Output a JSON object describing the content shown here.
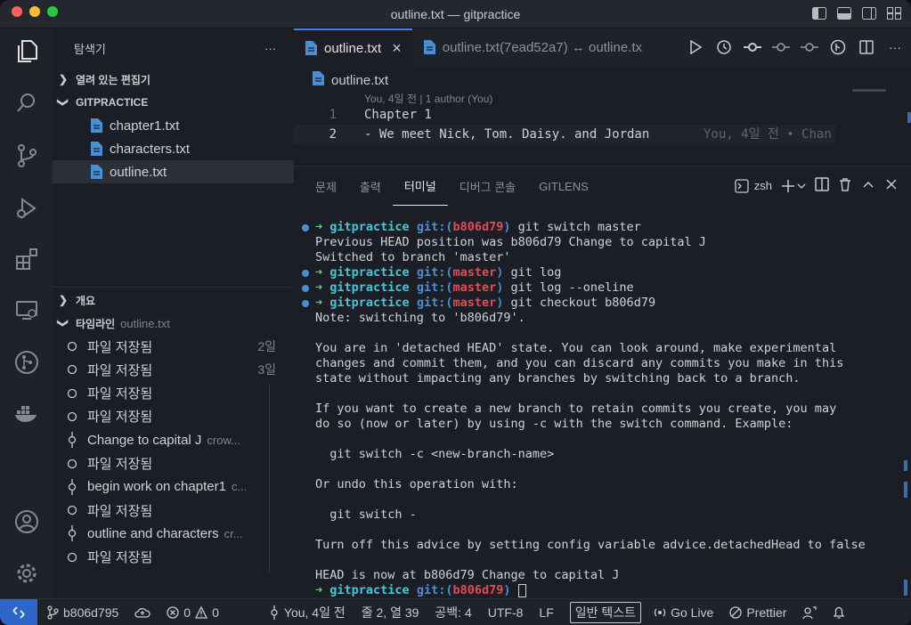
{
  "window": {
    "title": "outline.txt — gitpractice"
  },
  "sidebar": {
    "title": "탐색기",
    "more": "···",
    "open_editors": "열려 있는 편집기",
    "folder": "GITPRACTICE",
    "files": [
      "chapter1.txt",
      "characters.txt",
      "outline.txt"
    ],
    "outline_section": "개요",
    "timeline_section": "타임라인",
    "timeline_file": "outline.txt",
    "timeline": [
      {
        "label": "파일 저장됨",
        "meta": "",
        "time": "2일"
      },
      {
        "label": "파일 저장됨",
        "meta": "",
        "time": "3일"
      },
      {
        "label": "파일 저장됨",
        "meta": "",
        "time": ""
      },
      {
        "label": "파일 저장됨",
        "meta": "",
        "time": ""
      },
      {
        "label": "Change to capital J",
        "meta": "crow...",
        "time": ""
      },
      {
        "label": "파일 저장됨",
        "meta": "",
        "time": ""
      },
      {
        "label": "begin work on chapter1",
        "meta": "c...",
        "time": ""
      },
      {
        "label": "파일 저장됨",
        "meta": "",
        "time": ""
      },
      {
        "label": "outline and characters",
        "meta": "cr...",
        "time": ""
      },
      {
        "label": "파일 저장됨",
        "meta": "",
        "time": ""
      }
    ]
  },
  "editor": {
    "tabs": [
      {
        "label": "outline.txt",
        "close": "×"
      },
      {
        "label": "outline.txt(7ead52a7) ↔ outline.tx"
      }
    ],
    "breadcrumb": "outline.txt",
    "blame_header": "You, 4일 전 | 1 author (You)",
    "lines": [
      {
        "num": "1",
        "text": "Chapter 1"
      },
      {
        "num": "2",
        "text": "- We meet Nick, Tom. Daisy. and Jordan"
      }
    ],
    "inline_blame": "You, 4일 전 • Chan"
  },
  "panel": {
    "tabs": [
      "문제",
      "출력",
      "터미널",
      "디버그 콘솔",
      "GITLENS"
    ],
    "shell": "zsh",
    "terminal": [
      {
        "kind": "prompt",
        "branch": "b806d79",
        "cmd": " git switch master"
      },
      {
        "kind": "text",
        "text": "Previous HEAD position was b806d79 Change to capital J"
      },
      {
        "kind": "text",
        "text": "Switched to branch 'master'"
      },
      {
        "kind": "prompt",
        "branch": "master",
        "cmd": " git log"
      },
      {
        "kind": "prompt",
        "branch": "master",
        "cmd": " git log --oneline"
      },
      {
        "kind": "prompt",
        "branch": "master",
        "cmd": " git checkout b806d79"
      },
      {
        "kind": "text",
        "text": "Note: switching to 'b806d79'."
      },
      {
        "kind": "text",
        "text": ""
      },
      {
        "kind": "text",
        "text": "You are in 'detached HEAD' state. You can look around, make experimental"
      },
      {
        "kind": "text",
        "text": "changes and commit them, and you can discard any commits you make in this"
      },
      {
        "kind": "text",
        "text": "state without impacting any branches by switching back to a branch."
      },
      {
        "kind": "text",
        "text": ""
      },
      {
        "kind": "text",
        "text": "If you want to create a new branch to retain commits you create, you may"
      },
      {
        "kind": "text",
        "text": "do so (now or later) by using -c with the switch command. Example:"
      },
      {
        "kind": "text",
        "text": ""
      },
      {
        "kind": "text",
        "text": "  git switch -c <new-branch-name>"
      },
      {
        "kind": "text",
        "text": ""
      },
      {
        "kind": "text",
        "text": "Or undo this operation with:"
      },
      {
        "kind": "text",
        "text": ""
      },
      {
        "kind": "text",
        "text": "  git switch -"
      },
      {
        "kind": "text",
        "text": ""
      },
      {
        "kind": "text",
        "text": "Turn off this advice by setting config variable advice.detachedHead to false"
      },
      {
        "kind": "text",
        "text": ""
      },
      {
        "kind": "text",
        "text": "HEAD is now at b806d79 Change to capital J"
      },
      {
        "kind": "input",
        "branch": "b806d79",
        "cmd": " "
      }
    ],
    "prompt": {
      "arrow": "➜",
      "repo": "gitpractice",
      "git": "git:(",
      "close": ")"
    }
  },
  "status": {
    "branch": "b806d795",
    "errors": "0",
    "warnings": "0",
    "blame": "You, 4일 전",
    "position": "줄 2, 열 39",
    "spaces": "공백: 4",
    "encoding": "UTF-8",
    "eol": "LF",
    "language": "일반 텍스트",
    "golive": "Go Live",
    "prettier": "Prettier"
  },
  "colors": {
    "accent": "#2e65c9",
    "prompt_arrow": "#5fd07a",
    "repo": "#46c7d8",
    "branch": "#e24c56"
  }
}
